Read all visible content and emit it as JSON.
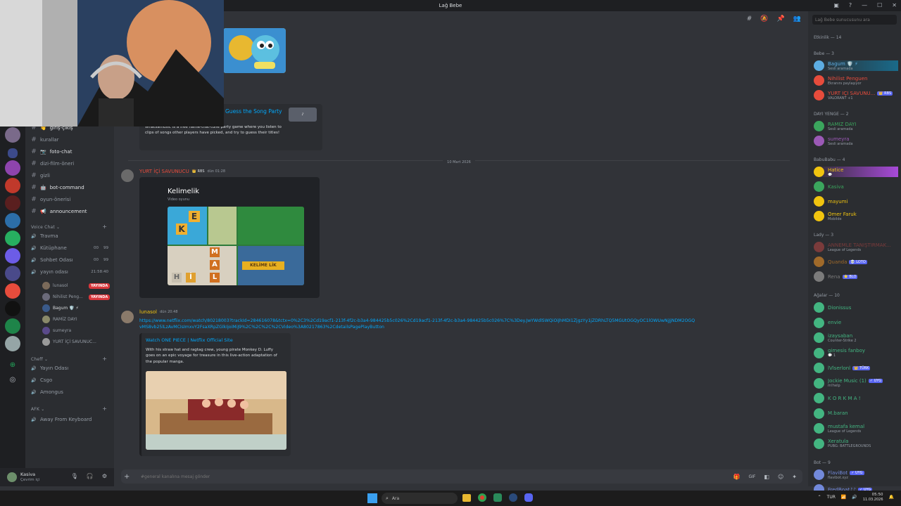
{
  "window": {
    "title": "Lağ Bebe"
  },
  "search": {
    "placeholder": "Lağ Bebe sunucusunu ara"
  },
  "channels": {
    "text": [
      {
        "label": "giriş-çıkış",
        "emoji": "👋",
        "bright": true
      },
      {
        "label": "kurallar",
        "bright": false
      },
      {
        "label": "foto-chat",
        "emoji": "📷",
        "bright": true
      },
      {
        "label": "dizi-film-öneri",
        "bright": false
      },
      {
        "label": "gizli",
        "bright": false
      },
      {
        "label": "bot-command",
        "emoji": "🤖",
        "bright": true
      },
      {
        "label": "oyun-önerisi",
        "bright": false
      },
      {
        "label": "announcement",
        "emoji": "📢",
        "bright": true
      }
    ],
    "voice_category": "Voice Chat",
    "voice": [
      {
        "label": "Travma"
      },
      {
        "label": "Kütüphane",
        "count1": "00",
        "count2": "99"
      },
      {
        "label": "Sohbet Odası",
        "count1": "00",
        "count2": "99"
      },
      {
        "label": "yayın odası",
        "timer": "21:58:40"
      }
    ],
    "voice_users": [
      {
        "name": "lunasol",
        "live": "YAYINDA",
        "color": "#949ba4"
      },
      {
        "name": "Nihilist Peng...",
        "live": "YAYINDA",
        "color": "#949ba4"
      },
      {
        "name": "Bagum 🛡️ ⚡",
        "color": "#dbdee1"
      },
      {
        "name": "RAMİZ DAYI",
        "color": "#949ba4"
      },
      {
        "name": "sumeyra",
        "color": "#949ba4"
      },
      {
        "name": "YURT İÇİ SAVUNUC...",
        "color": "#949ba4"
      }
    ],
    "chef_category": "Cheff",
    "chef": [
      {
        "label": "Yayın Odası"
      },
      {
        "label": "Csgo"
      },
      {
        "label": "Amongus"
      }
    ],
    "afk_category": "AFK",
    "afk": [
      {
        "label": "Away From Keyboard"
      }
    ]
  },
  "user_panel": {
    "name": "Kasiva",
    "status": "Çevrim içi"
  },
  "messages": {
    "game_embed": {
      "title": "Guess the Song Party",
      "desc": "Whatsamusic is a free name-that-tune party game where you listen to clips of songs other players have picked, and try to guess their titles!"
    },
    "date_divider": "10 Mart 2026",
    "msg1": {
      "author": "YURT İÇİ SAVUNUCU",
      "badge": "👑 RBS",
      "time": "dün 01:28"
    },
    "activity": {
      "title": "Kelimelik",
      "subtitle": "Video oyunu",
      "tiles": [
        "K",
        "E",
        "M",
        "A",
        "L",
        "İ",
        "H"
      ],
      "banner": "KELİME LİK"
    },
    "msg2": {
      "author": "lunasol",
      "time": "dün 20:48",
      "url": "https://www.netflix.com/watch/80218003?trackId=284616078&tctx=0%2C3%2Cd19acf1-213f-4f2c-b3a4-984425b5c026%2Cd19acf1-213f-4f2c-b3a4-984425b5c026%7C%3Dey.JwYWdlSWQiOiJhMDI1ZjgzYy1jZDRhLTQ5MGUtOGQyOC1lOWUwNjJjNDM2OGQvMS8vb25lLzAvMCIsImxvY2FsaXRpZGlkIjoiMiJ9%2C%2C%2C%2CVideo%3A80217863%2CdetailsPagePlayButton",
      "embed_title": "Watch ONE PIECE | Netflix Official Site",
      "embed_desc": "With his straw hat and ragtag crew, young pirate Monkey D. Luffy goes on an epic voyage for treasure in this live-action adaptation of the popular manga."
    }
  },
  "input": {
    "placeholder": "#general kanalına mesaj gönder"
  },
  "members": {
    "sections": [
      {
        "title": "Etkinlik — 14",
        "members": []
      },
      {
        "title": "Bebe — 3",
        "members": [
          {
            "name": "Bagum 🛡️ ⚡",
            "status": "Sesli aramada",
            "color": "#5dade2",
            "bg": "#1a6a8a"
          },
          {
            "name": "Nihilist Penguen",
            "status": "Ekranını paylaşıyor",
            "color": "#e74c3c"
          },
          {
            "name": "YURT İÇİ SAVUNU...",
            "status": "VALORANT +1",
            "color": "#e74c3c",
            "badge": "👑 RBS"
          }
        ]
      },
      {
        "title": "DAYI YENGE — 2",
        "members": [
          {
            "name": "RAMİZ DAYI",
            "status": "Sesli aramada",
            "color": "#3ba55d"
          },
          {
            "name": "sumeyra",
            "status": "Sesli aramada",
            "color": "#9b59b6"
          }
        ]
      },
      {
        "title": "BabuBabu — 4",
        "members": [
          {
            "name": "Hatice",
            "status": "💬",
            "color": "#f1c40f",
            "bg": "#a84ad9"
          },
          {
            "name": "Kasiva",
            "status": "",
            "color": "#3ba55d"
          },
          {
            "name": "mayumi",
            "status": "",
            "color": "#f1c40f"
          },
          {
            "name": "Ömer Faruk",
            "status": "Mobilde",
            "color": "#f1c40f"
          }
        ]
      },
      {
        "title": "Lady — 3",
        "members": [
          {
            "name": "ANNEMLE TANIŞTIRMAK...",
            "status": "League of Legends",
            "color": "#7a3b3b"
          },
          {
            "name": "Quanda",
            "status": "",
            "color": "#a06a2a",
            "badge": "💀 LOTO"
          },
          {
            "name": "Rena",
            "status": "",
            "color": "#7b7b7b",
            "badge": "⭐ BLO"
          }
        ]
      },
      {
        "title": "Ağalar — 10",
        "members": [
          {
            "name": "Dionissus",
            "status": "",
            "color": "#43b581"
          },
          {
            "name": "envie",
            "status": "",
            "color": "#43b581"
          },
          {
            "name": "izaysaban",
            "status": "Counter-Strike 2",
            "color": "#43b581"
          },
          {
            "name": "gimesis fanboy",
            "status": "💬 1",
            "color": "#43b581"
          },
          {
            "name": "lVlserlonl",
            "status": "",
            "color": "#43b581",
            "badge": "👑 TÜRK"
          },
          {
            "name": "Jockie Music (1)",
            "status": "m!help",
            "color": "#43b581",
            "badge": "✓ UYG"
          },
          {
            "name": "K O R K M A !",
            "status": "",
            "color": "#43b581"
          },
          {
            "name": "M.baran",
            "status": "",
            "color": "#43b581"
          },
          {
            "name": "mustafa kemal",
            "status": "League of Legends",
            "color": "#43b581"
          },
          {
            "name": "Xeratula",
            "status": "PUBG: BATTLEGROUNDS",
            "color": "#43b581"
          }
        ]
      },
      {
        "title": "Bot — 9",
        "members": [
          {
            "name": "FlaviBot",
            "status": "flavibot.xyz",
            "color": "#7289da",
            "badge": "✓ UYG"
          },
          {
            "name": "FredBoat♪♪",
            "status": "",
            "color": "#7289da",
            "badge": "✓ UYG"
          }
        ]
      }
    ]
  },
  "taskbar": {
    "search": "Ara",
    "lang": "TUR",
    "time": "05:50",
    "date": "11.03.2026"
  },
  "colors": {
    "accent": "#5865f2",
    "live": "#da373c",
    "link": "#00a8fc"
  }
}
